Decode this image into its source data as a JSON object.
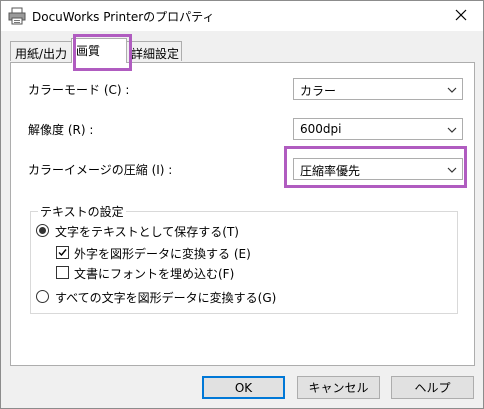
{
  "window": {
    "title": "DocuWorks Printerのプロパティ"
  },
  "tabs": [
    {
      "label": "用紙/出力"
    },
    {
      "label": "画質"
    },
    {
      "label": "詳細設定"
    }
  ],
  "settings": {
    "color_mode": {
      "label": "カラーモード (C) :",
      "value": "カラー"
    },
    "resolution": {
      "label": "解像度 (R) :",
      "value": "600dpi"
    },
    "color_compression": {
      "label": "カラーイメージの圧縮 (I) :",
      "value": "圧縮率優先"
    }
  },
  "text_settings": {
    "legend": "テキストの設定",
    "save_as_text": {
      "label": "文字をテキストとして保存する(T)",
      "checked": true
    },
    "convert_external_chars": {
      "label": "外字を図形データに変換する (E)",
      "checked": true
    },
    "embed_fonts": {
      "label": "文書にフォントを埋め込む(F)",
      "checked": false
    },
    "convert_all": {
      "label": "すべての文字を図形データに変換する(G)",
      "checked": false
    }
  },
  "buttons": {
    "ok": "OK",
    "cancel": "キャンセル",
    "help": "ヘルプ"
  },
  "colors": {
    "highlight": "#b05cc0",
    "default_button_border": "#0078d7"
  },
  "icons": {
    "app": "printer-icon",
    "close": "close-icon",
    "dropdown": "chevron-down-icon"
  }
}
